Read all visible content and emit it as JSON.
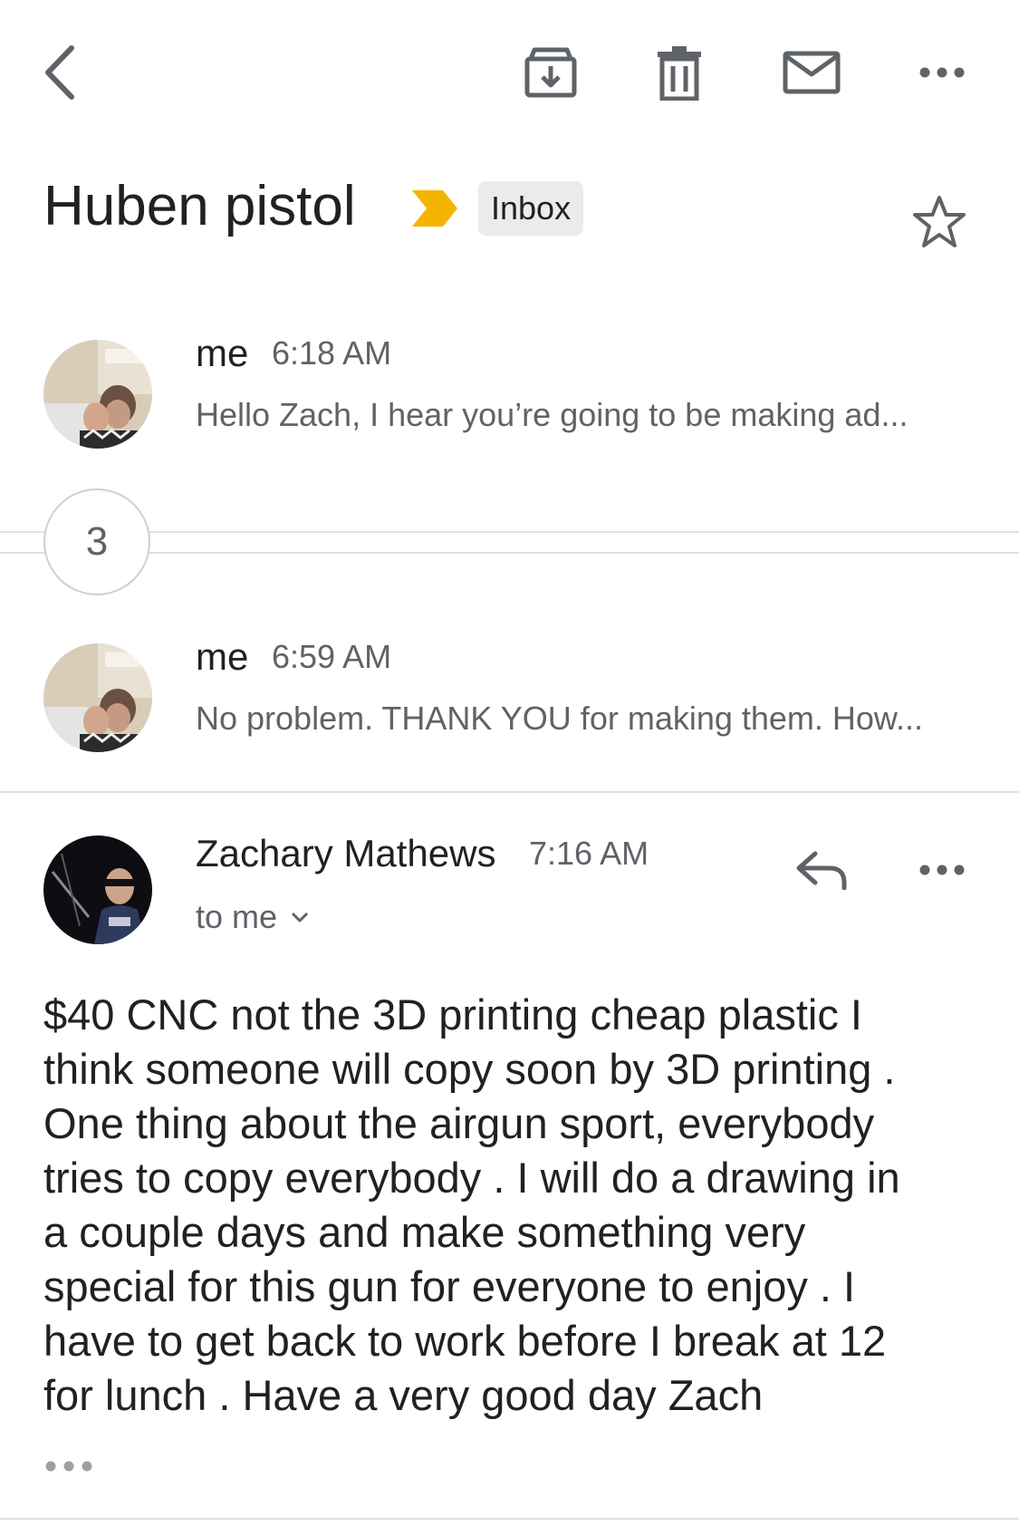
{
  "toolbar": {
    "back_icon": "back-arrow-icon",
    "archive_icon": "archive-icon",
    "delete_icon": "trash-icon",
    "mark_unread_icon": "mail-icon",
    "more_icon": "more-horizontal-icon"
  },
  "thread": {
    "subject": "Huben pistol",
    "label": "Inbox",
    "importance_color": "#f4b400"
  },
  "messages": [
    {
      "sender": "me",
      "time": "6:18 AM",
      "snippet": "Hello Zach, I hear you’re going to be making ad..."
    },
    {
      "collapsed_count": "3"
    },
    {
      "sender": "me",
      "time": "6:59 AM",
      "snippet": "No problem. THANK YOU for making them. How..."
    }
  ],
  "expanded_message": {
    "sender": "Zachary Mathews",
    "time": "7:16 AM",
    "recipient": "to me",
    "body": [
      "$40 CNC not the 3D printing cheap plastic I",
      "think someone will copy soon by 3D printing .",
      "One thing about the airgun sport, everybody",
      "tries to copy everybody . I will do a drawing in",
      "a couple days and make something very",
      "special for this gun for everyone to enjoy . I",
      "have to get back to work before I break at 12",
      "for lunch . Have a very good day Zach"
    ]
  }
}
